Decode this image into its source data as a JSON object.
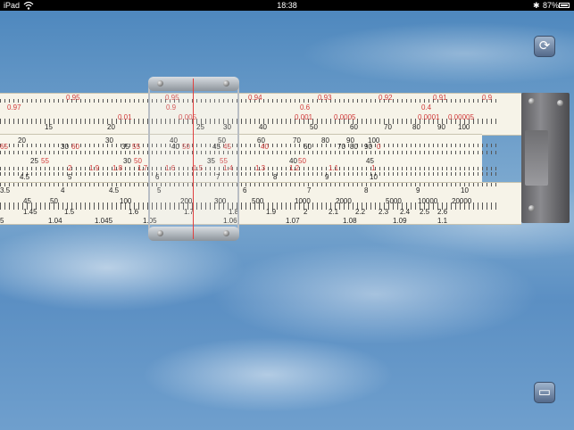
{
  "status_bar": {
    "device": "iPad",
    "time": "18:38",
    "battery": "87%"
  },
  "buttons": {
    "rotate_icon": "rotate-icon",
    "settings_icon": "slide-rule-icon"
  },
  "stock_top": {
    "row1": [
      "0.95",
      "0.95",
      "0.94",
      "0.93",
      "0.92",
      "0.91",
      "0.9",
      "0.97",
      "0.9",
      "0.6",
      "0.4"
    ],
    "row2": [
      "0.01",
      "0.005",
      "0.001",
      "0.0005",
      "0.0001",
      "0.00005"
    ],
    "row3": [
      "15",
      "20",
      "25",
      "30",
      "40",
      "50",
      "60",
      "70",
      "80",
      "90",
      "100"
    ]
  },
  "slide": {
    "row1": [
      "65",
      "20",
      "30",
      "60",
      "30",
      "35",
      "55",
      "40",
      "50",
      "60",
      "70",
      "80",
      "90",
      "100"
    ],
    "row2": [
      "25",
      "55",
      "30",
      "40",
      "50",
      "45",
      "45",
      "45",
      "35",
      "55",
      "50",
      "40",
      "60",
      "70",
      "80",
      "90",
      "0"
    ],
    "row3": [
      "2",
      "1.9",
      "1.8",
      "1.7",
      "1.6",
      "1.5",
      "1.4",
      "1.3",
      "1.2",
      "1.1",
      "1"
    ],
    "row4": [
      "4.5",
      "5",
      "6",
      "7",
      "8",
      "9",
      "10",
      "40",
      "50"
    ]
  },
  "stock_bot": {
    "row1": [
      "3.5",
      "4",
      "4.5",
      "5",
      "6",
      "7",
      "8",
      "9",
      "10"
    ],
    "row2": [
      "45",
      "50",
      "100",
      "200",
      "300",
      "500",
      "1000",
      "2000",
      "5000",
      "10000",
      "20000"
    ],
    "row3": [
      "1.45",
      "1.5",
      "1.6",
      "1.7",
      "1.8",
      "1.9",
      "2",
      "2.1",
      "2.2",
      "2.3",
      "2.4",
      "2.5",
      "2.6"
    ],
    "row4": [
      "5",
      "1.04",
      "1.045",
      "1.05",
      "1.06",
      "1.07",
      "1.08",
      "1.09",
      "1.1"
    ]
  }
}
